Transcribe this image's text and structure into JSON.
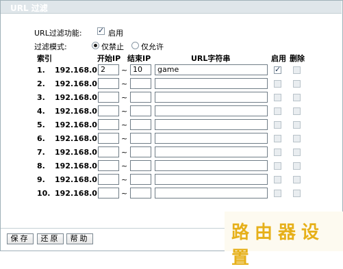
{
  "page": {
    "title": "URL 过滤",
    "function_label": "URL过滤功能:",
    "enable_label": "启用",
    "enabled": true,
    "mode_label": "过滤模式:",
    "mode_options": [
      "仅禁止",
      "仅允许"
    ],
    "mode_selected": "仅禁止"
  },
  "table": {
    "headers": {
      "index": "索引",
      "start_ip": "开始IP",
      "end_ip": "结束IP",
      "url": "URL字符串",
      "enable": "启用",
      "delete": "删除"
    },
    "ip_prefix": "192.168.0.",
    "separator": "~",
    "rows": [
      {
        "index": "1.",
        "start": "2",
        "end": "10",
        "url": "game",
        "enabled": true,
        "delete": false
      },
      {
        "index": "2.",
        "start": "",
        "end": "",
        "url": "",
        "enabled": false,
        "delete": false
      },
      {
        "index": "3.",
        "start": "",
        "end": "",
        "url": "",
        "enabled": false,
        "delete": false
      },
      {
        "index": "4.",
        "start": "",
        "end": "",
        "url": "",
        "enabled": false,
        "delete": false
      },
      {
        "index": "5.",
        "start": "",
        "end": "",
        "url": "",
        "enabled": false,
        "delete": false
      },
      {
        "index": "6.",
        "start": "",
        "end": "",
        "url": "",
        "enabled": false,
        "delete": false
      },
      {
        "index": "7.",
        "start": "",
        "end": "",
        "url": "",
        "enabled": false,
        "delete": false
      },
      {
        "index": "8.",
        "start": "",
        "end": "",
        "url": "",
        "enabled": false,
        "delete": false
      },
      {
        "index": "9.",
        "start": "",
        "end": "",
        "url": "",
        "enabled": false,
        "delete": false
      },
      {
        "index": "10.",
        "start": "",
        "end": "",
        "url": "",
        "enabled": false,
        "delete": false
      }
    ]
  },
  "buttons": {
    "save": "保存",
    "restore": "还原",
    "help": "帮助"
  },
  "watermark": {
    "text": "路由器设置"
  },
  "colors": {
    "title_bar": "#dfe6ea",
    "watermark": "#e6b01a"
  }
}
